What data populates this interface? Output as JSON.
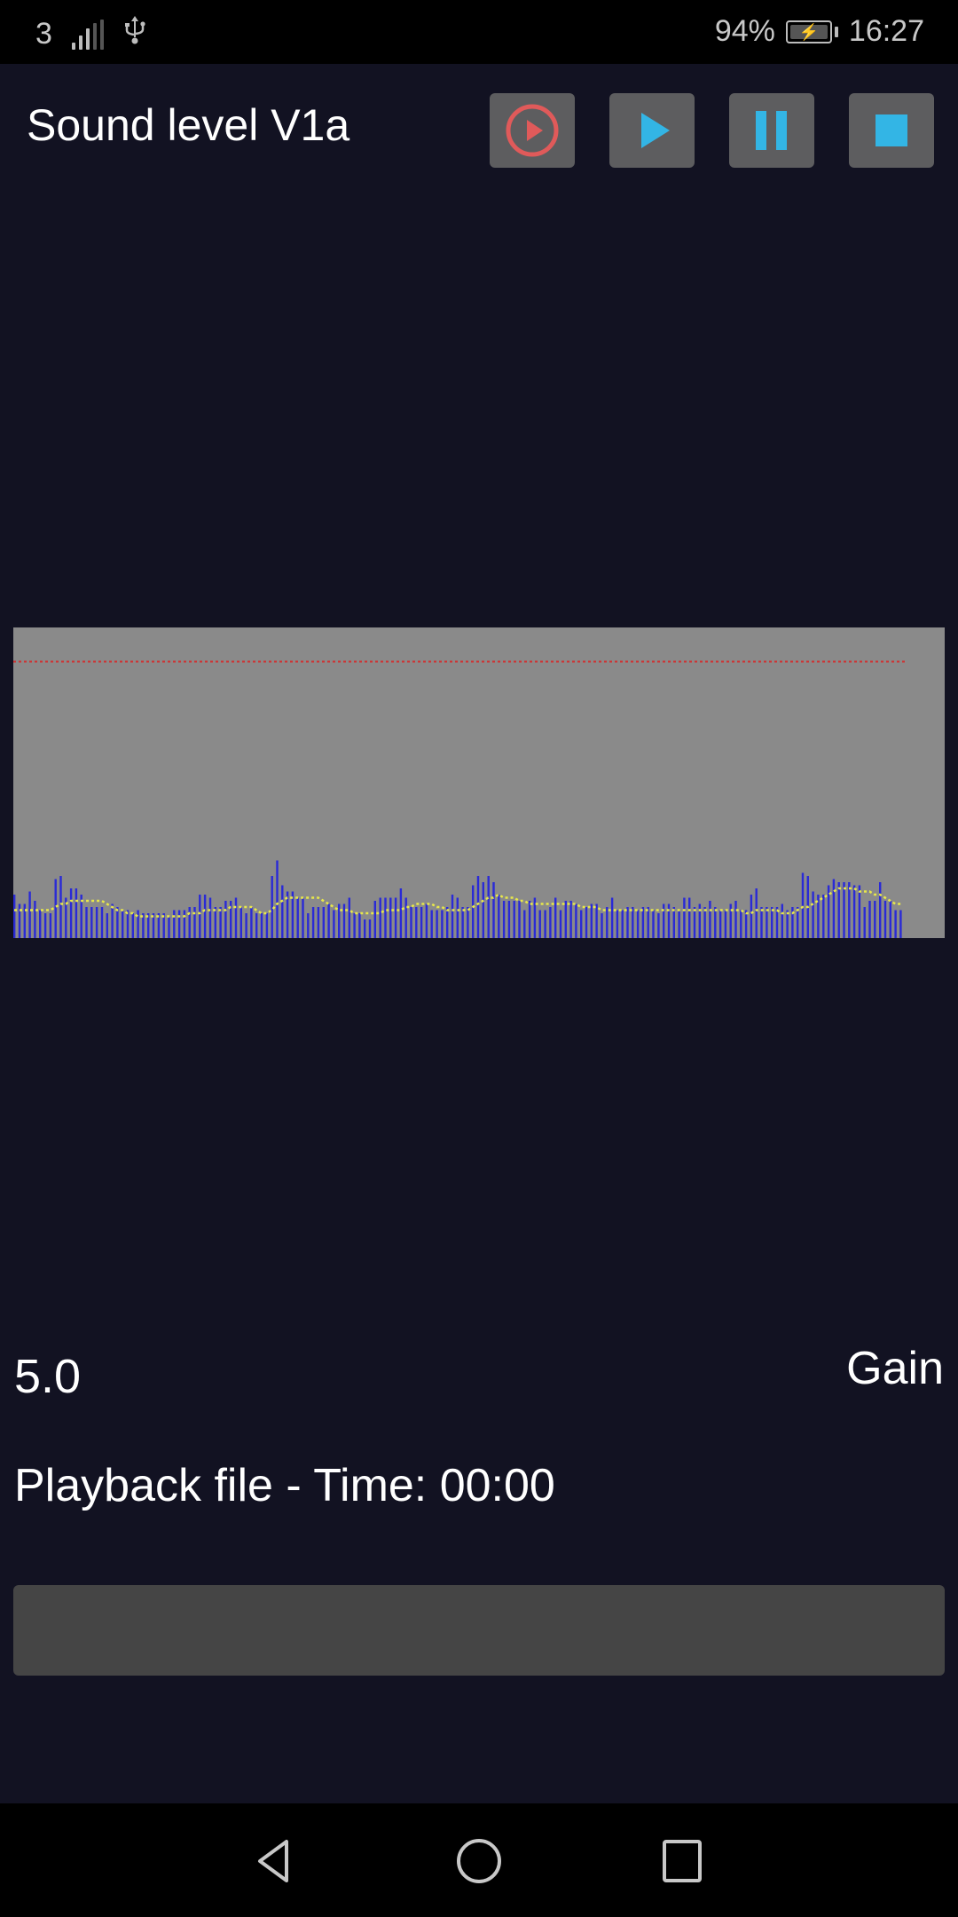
{
  "statusbar": {
    "carrier": "3",
    "battery_percent": "94%",
    "time": "16:27",
    "icons": [
      "signal-icon",
      "usb-icon",
      "battery-charging-icon"
    ]
  },
  "app": {
    "title": "Sound level V1a",
    "controls": [
      {
        "name": "record-play-button",
        "icon": "record-play-icon",
        "color": "#e05a5a"
      },
      {
        "name": "play-button",
        "icon": "play-icon",
        "color": "#33b5e5"
      },
      {
        "name": "pause-button",
        "icon": "pause-icon",
        "color": "#33b5e5"
      },
      {
        "name": "stop-button",
        "icon": "stop-icon",
        "color": "#33b5e5"
      }
    ]
  },
  "colors": {
    "background": "#121222",
    "chart_bg": "#8a8a8a",
    "bar": "#2a2ad6",
    "threshold": "#d03030",
    "average": "#e8e84a",
    "progress_bg": "#454545"
  },
  "gain": {
    "value": "5.0",
    "label": "Gain"
  },
  "playback": {
    "text": "Playback file - Time: 00:00",
    "progress": 0
  },
  "navbar": {
    "icons": [
      "back-icon",
      "home-icon",
      "recents-icon"
    ]
  },
  "chart_data": {
    "type": "bar",
    "title": "",
    "xlabel": "",
    "ylabel": "",
    "ylim": [
      0,
      1
    ],
    "threshold": 0.89,
    "values": [
      0.14,
      0.11,
      0.11,
      0.15,
      0.12,
      0.09,
      0.08,
      0.08,
      0.19,
      0.2,
      0.13,
      0.16,
      0.16,
      0.14,
      0.1,
      0.1,
      0.1,
      0.1,
      0.08,
      0.11,
      0.1,
      0.09,
      0.09,
      0.08,
      0.09,
      0.08,
      0.08,
      0.08,
      0.08,
      0.08,
      0.07,
      0.09,
      0.09,
      0.09,
      0.1,
      0.1,
      0.14,
      0.14,
      0.13,
      0.1,
      0.1,
      0.12,
      0.12,
      0.13,
      0.1,
      0.08,
      0.1,
      0.08,
      0.08,
      0.08,
      0.2,
      0.25,
      0.17,
      0.15,
      0.15,
      0.13,
      0.13,
      0.08,
      0.1,
      0.1,
      0.1,
      0.11,
      0.09,
      0.11,
      0.11,
      0.13,
      0.08,
      0.08,
      0.06,
      0.06,
      0.12,
      0.13,
      0.13,
      0.13,
      0.13,
      0.16,
      0.13,
      0.1,
      0.1,
      0.1,
      0.11,
      0.09,
      0.09,
      0.09,
      0.1,
      0.14,
      0.13,
      0.1,
      0.1,
      0.17,
      0.2,
      0.18,
      0.2,
      0.18,
      0.14,
      0.12,
      0.12,
      0.12,
      0.12,
      0.09,
      0.12,
      0.13,
      0.09,
      0.09,
      0.1,
      0.13,
      0.09,
      0.12,
      0.12,
      0.11,
      0.09,
      0.1,
      0.11,
      0.11,
      0.08,
      0.1,
      0.13,
      0.09,
      0.09,
      0.1,
      0.1,
      0.09,
      0.1,
      0.1,
      0.09,
      0.08,
      0.11,
      0.11,
      0.1,
      0.09,
      0.13,
      0.13,
      0.1,
      0.11,
      0.1,
      0.12,
      0.1,
      0.09,
      0.09,
      0.11,
      0.12,
      0.09,
      0.09,
      0.14,
      0.16,
      0.1,
      0.1,
      0.1,
      0.1,
      0.11,
      0.09,
      0.1,
      0.1,
      0.21,
      0.2,
      0.15,
      0.14,
      0.14,
      0.17,
      0.19,
      0.18,
      0.18,
      0.18,
      0.17,
      0.17,
      0.1,
      0.12,
      0.12,
      0.18,
      0.12,
      0.12,
      0.09,
      0.09
    ],
    "average": [
      0.09,
      0.09,
      0.09,
      0.09,
      0.09,
      0.09,
      0.09,
      0.09,
      0.1,
      0.11,
      0.11,
      0.12,
      0.12,
      0.12,
      0.12,
      0.12,
      0.12,
      0.12,
      0.11,
      0.1,
      0.09,
      0.09,
      0.08,
      0.08,
      0.07,
      0.07,
      0.07,
      0.07,
      0.07,
      0.07,
      0.07,
      0.07,
      0.07,
      0.07,
      0.08,
      0.08,
      0.08,
      0.09,
      0.09,
      0.09,
      0.09,
      0.09,
      0.1,
      0.1,
      0.1,
      0.1,
      0.1,
      0.09,
      0.08,
      0.08,
      0.09,
      0.11,
      0.12,
      0.13,
      0.13,
      0.13,
      0.13,
      0.13,
      0.13,
      0.13,
      0.12,
      0.11,
      0.1,
      0.09,
      0.09,
      0.09,
      0.08,
      0.08,
      0.08,
      0.08,
      0.08,
      0.08,
      0.09,
      0.09,
      0.09,
      0.09,
      0.1,
      0.1,
      0.11,
      0.11,
      0.11,
      0.11,
      0.1,
      0.1,
      0.09,
      0.09,
      0.09,
      0.09,
      0.09,
      0.1,
      0.11,
      0.12,
      0.13,
      0.13,
      0.14,
      0.13,
      0.13,
      0.13,
      0.12,
      0.12,
      0.11,
      0.11,
      0.11,
      0.11,
      0.11,
      0.11,
      0.11,
      0.11,
      0.11,
      0.11,
      0.1,
      0.1,
      0.1,
      0.1,
      0.09,
      0.09,
      0.09,
      0.09,
      0.09,
      0.09,
      0.09,
      0.09,
      0.09,
      0.09,
      0.09,
      0.09,
      0.09,
      0.09,
      0.09,
      0.09,
      0.09,
      0.09,
      0.09,
      0.09,
      0.09,
      0.09,
      0.09,
      0.09,
      0.09,
      0.09,
      0.09,
      0.09,
      0.08,
      0.08,
      0.09,
      0.09,
      0.09,
      0.09,
      0.09,
      0.08,
      0.08,
      0.08,
      0.09,
      0.1,
      0.1,
      0.11,
      0.12,
      0.13,
      0.14,
      0.15,
      0.16,
      0.16,
      0.16,
      0.16,
      0.15,
      0.15,
      0.15,
      0.14,
      0.14,
      0.13,
      0.12,
      0.11,
      0.11
    ]
  }
}
